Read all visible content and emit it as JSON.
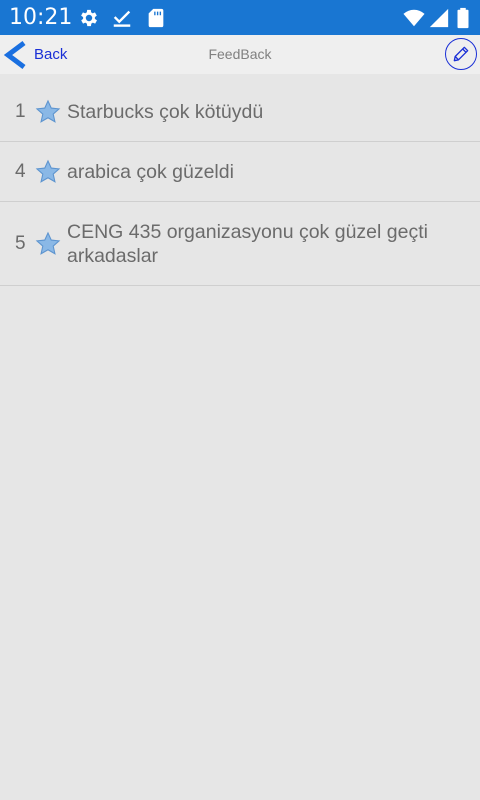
{
  "status_bar": {
    "time": "10:21",
    "background_color": "#1976d2",
    "icons": [
      "gear-icon",
      "checkmark-icon",
      "sd-card-icon",
      "wifi-icon",
      "signal-icon",
      "battery-icon"
    ]
  },
  "nav": {
    "back_label": "Back",
    "title": "FeedBack",
    "accent_color": "#1a2fd6",
    "edit_icon": "pencil-icon"
  },
  "feedback_list": [
    {
      "number": "1",
      "text": "Starbucks çok kötüydü",
      "icon": "star-icon"
    },
    {
      "number": "4",
      "text": "arabica çok güzeldi",
      "icon": "star-icon"
    },
    {
      "number": "5",
      "text": "CENG 435 organizasyonu çok güzel geçti arkadaslar",
      "icon": "star-icon"
    }
  ]
}
